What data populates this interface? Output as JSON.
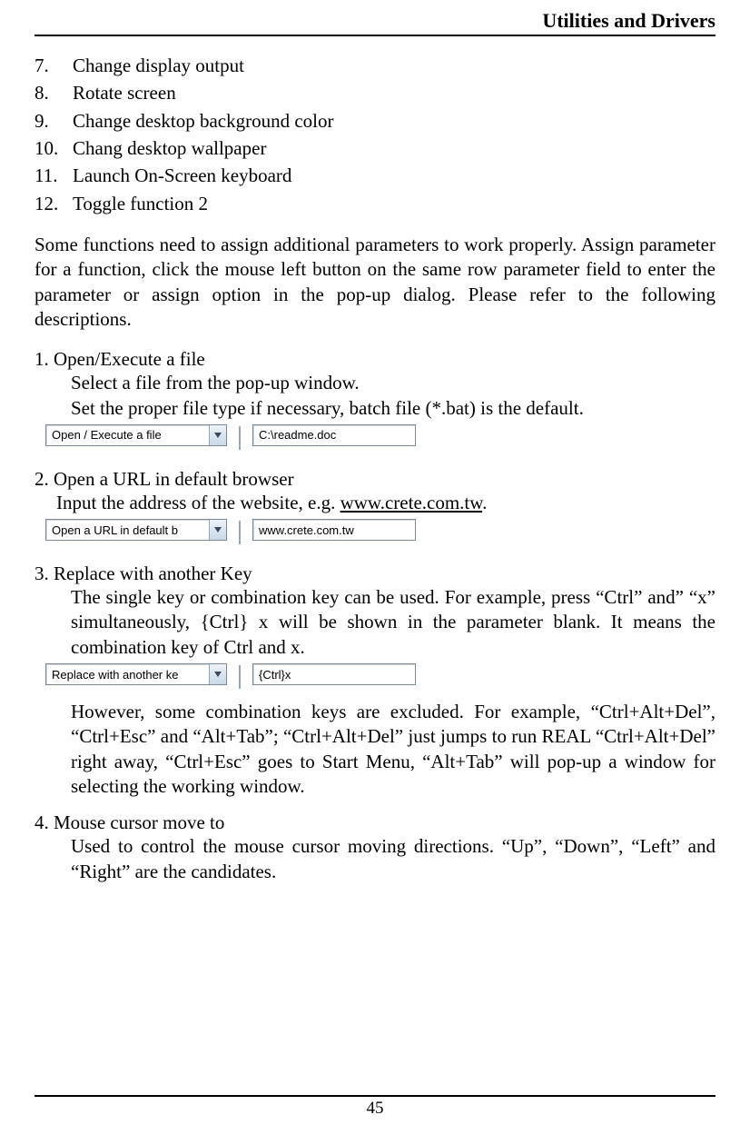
{
  "header": {
    "title": "Utilities and Drivers"
  },
  "list": {
    "start": 7,
    "items": [
      "Change display output",
      "Rotate screen",
      "Change desktop background color",
      "Chang desktop wallpaper",
      "Launch On-Screen keyboard",
      "Toggle function 2"
    ]
  },
  "intro_para": "Some functions need to assign additional parameters to work properly. Assign parameter for a function, click the mouse left button on the same row parameter field to enter the parameter or assign option in the pop-up dialog.  Please refer to the following descriptions.",
  "s1": {
    "title": "1. Open/Execute a file",
    "line1": "Select a file from the pop-up window.",
    "line2": "Set the proper file type if necessary, batch file (*.bat) is the default.",
    "dropdown": "Open / Execute a file",
    "value": "C:\\readme.doc"
  },
  "s2": {
    "title": "2. Open a URL in default browser",
    "line1_pre": "Input the address of the website, e.g. ",
    "line1_link": "www.crete.com.tw",
    "line1_post": ".",
    "dropdown": "Open a URL in default b",
    "value": "www.crete.com.tw"
  },
  "s3": {
    "title": "3. Replace with another Key",
    "para1": "The single key or combination key can be used. For example, press “Ctrl” and” “x” simultaneously, {Ctrl} x will be shown in the parameter blank. It means the combination key of Ctrl and x.",
    "dropdown": "Replace with another ke",
    "value": "{Ctrl}x",
    "para2": "However, some combination keys are excluded. For example, “Ctrl+Alt+Del”, “Ctrl+Esc” and “Alt+Tab”;  “Ctrl+Alt+Del” just jumps to run REAL “Ctrl+Alt+Del” right away, “Ctrl+Esc” goes to Start Menu, “Alt+Tab” will pop-up a window for selecting the working window."
  },
  "s4": {
    "title": "4. Mouse cursor move to",
    "para": "Used to control the mouse cursor moving directions. “Up”, “Down”, “Left” and “Right” are the candidates."
  },
  "footer": {
    "page": "45"
  }
}
